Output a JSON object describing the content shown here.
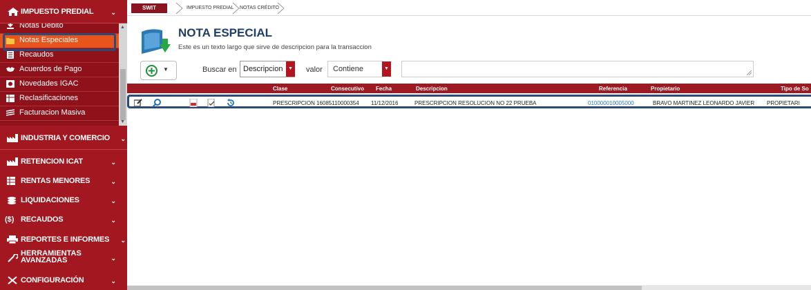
{
  "sidebar": {
    "header": {
      "label": "IMPUESTO PREDIAL"
    },
    "sub_items": [
      {
        "label": "Notas Debito"
      },
      {
        "label": "Notas Especiales"
      },
      {
        "label": "Recaudos"
      },
      {
        "label": "Acuerdos de Pago"
      },
      {
        "label": "Novedades IGAC"
      },
      {
        "label": "Reclasificaciones"
      },
      {
        "label": "Facturacion Masiva"
      }
    ],
    "modules": [
      {
        "label": "INDUSTRIA Y COMERCIO"
      },
      {
        "label": "RETENCION ICAT"
      },
      {
        "label": "RENTAS MENORES"
      },
      {
        "label": "LIQUIDACIONES"
      },
      {
        "label": "RECAUDOS"
      },
      {
        "label": "REPORTES E INFORMES"
      },
      {
        "label_line1": "HERRAMIENTAS",
        "label_line2": "AVANZADAS"
      },
      {
        "label": "CONFIGURACIÓN"
      }
    ],
    "recaudos_symbol": "($)"
  },
  "breadcrumb": {
    "root": "SWIT",
    "items": [
      "IMPUESTO PREDIAL",
      "NOTAS CRÉDITO"
    ]
  },
  "page": {
    "title": "NOTA ESPECIAL",
    "description": "Este es un texto largo que sirve de descripcion para la transaccion"
  },
  "toolbar": {
    "search_in_label": "Buscar en",
    "search_in_value": "Descripcion",
    "value_label": "valor",
    "operator_value": "Contiene",
    "search_text": ""
  },
  "table": {
    "headers": [
      "Clase",
      "Consecutivo",
      "Fecha",
      "Descripcion",
      "Referencia",
      "Propietario",
      "Tipo de So"
    ],
    "rows": [
      {
        "clase": "PRESCRIPCION",
        "consecutivo": "16085110000354",
        "fecha": "11/12/2016",
        "descripcion": "PRESCRIPCION RESOLUCION NO 22 PRUEBA",
        "referencia": "010000010005000",
        "propietario": "BRAVO MARTINEZ LEONARDO JAVIER",
        "tipo": "PROPIETARI"
      }
    ]
  },
  "colors": {
    "primary_red": "#a31720",
    "highlight_blue": "#2b4a78",
    "link_blue": "#2a7ab8",
    "title_navy": "#1f3d6b",
    "active_orange": "#e8541c"
  }
}
